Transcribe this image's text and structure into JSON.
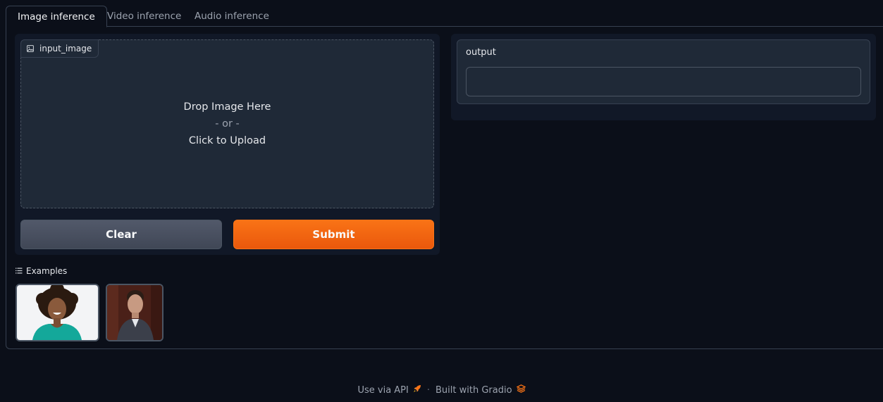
{
  "tabs": [
    {
      "label": "Image inference",
      "active": true
    },
    {
      "label": "Video inference",
      "active": false
    },
    {
      "label": "Audio inference",
      "active": false
    }
  ],
  "input_image": {
    "label": "input_image",
    "icon": "image-icon",
    "drop_text": "Drop Image Here",
    "or_text": "- or -",
    "upload_text": "Click to Upload"
  },
  "buttons": {
    "clear_label": "Clear",
    "submit_label": "Submit"
  },
  "output": {
    "label": "output",
    "value": ""
  },
  "examples": {
    "label": "Examples",
    "icon": "list-icon",
    "items": [
      {
        "name": "example-woman"
      },
      {
        "name": "example-man"
      }
    ]
  },
  "footer": {
    "api_label": "Use via API",
    "api_icon": "rocket-icon",
    "separator": "·",
    "built_label": "Built with Gradio",
    "built_icon": "gradio-logo-icon"
  },
  "colors": {
    "background": "#0b0f19",
    "block": "#111827",
    "input": "#1f2937",
    "border": "#374151",
    "accent": "#f97316"
  }
}
